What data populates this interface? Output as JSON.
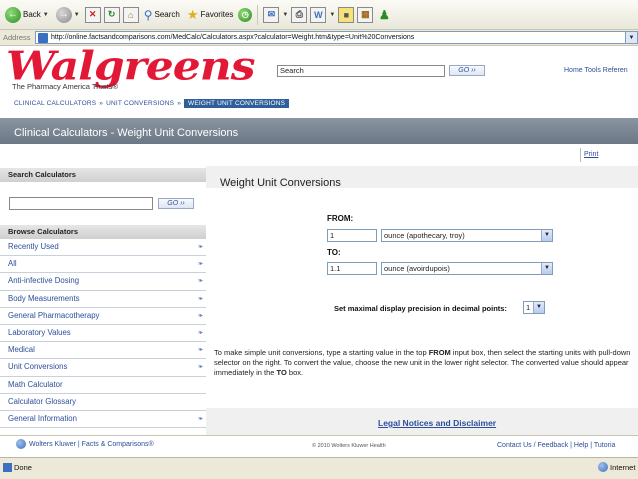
{
  "browser": {
    "back_label": "Back",
    "search_label": "Search",
    "favorites_label": "Favorites",
    "address_label": "Address",
    "url": "http://online.factsandcomparisons.com/MedCalc/Calculators.aspx?calculator=Weight.htm&type=Unit%20Conversions",
    "status_left": "Done",
    "status_right": "Internet"
  },
  "header": {
    "logo_text": "Walgreens",
    "tagline": "The Pharmacy America Trusts®",
    "search_value": "Search",
    "go_label": "GO ››",
    "top_links": "Home  Tools  Referen"
  },
  "breadcrumb": {
    "items": [
      "CLINICAL CALCULATORS",
      "UNIT CONVERSIONS",
      "WEIGHT UNIT CONVERSIONS"
    ],
    "separator": "»"
  },
  "page_title": "Clinical Calculators - Weight Unit Conversions",
  "sidebar": {
    "search_heading": "Search Calculators",
    "go_label": "GO ››",
    "browse_heading": "Browse Calculators",
    "chevron": "››▸",
    "items": [
      {
        "label": "Recently Used",
        "has_chevron": true
      },
      {
        "label": "All",
        "has_chevron": true
      },
      {
        "label": "Anti-infective Dosing",
        "has_chevron": true
      },
      {
        "label": "Body Measurements",
        "has_chevron": true
      },
      {
        "label": "General Pharmacotherapy",
        "has_chevron": true
      },
      {
        "label": "Laboratory Values",
        "has_chevron": true
      },
      {
        "label": "Medical",
        "has_chevron": true
      },
      {
        "label": "Unit Conversions",
        "has_chevron": true
      },
      {
        "label": "Math Calculator",
        "has_chevron": false
      },
      {
        "label": "Calculator Glossary",
        "has_chevron": false
      },
      {
        "label": "General Information",
        "has_chevron": true
      }
    ]
  },
  "content": {
    "print_label": "Print",
    "title": "Weight Unit Conversions",
    "from_label": "FROM:",
    "from_value": "1",
    "from_unit": "ounce (apothecary, troy)",
    "to_label": "TO:",
    "to_value": "1.1",
    "to_unit": "ounce (avoirdupois)",
    "precision_label": "Set maximal display precision in decimal points:",
    "precision_value": "1",
    "help_text_1": "To make simple unit conversions, type a starting value in the top ",
    "help_bold_1": "FROM",
    "help_text_2": " input box, then select the starting units with pull-down selector on the right. To convert the value, choose the new unit in the lower right selector. The converted value should appear immediately in the ",
    "help_bold_2": "TO",
    "help_text_3": " box.",
    "legal_link": "Legal Notices and Disclaimer"
  },
  "footer": {
    "brand": "Wolters Kluwer | Facts & Comparisons®",
    "copyright": "© 2010 Wolters Kluwer Health",
    "links": "Contact Us / Feedback  |  Help  |  Tutoria"
  },
  "colors": {
    "brand_red": "#e31837",
    "link_blue": "#2d4e9a",
    "title_bar": "#7a8591"
  }
}
